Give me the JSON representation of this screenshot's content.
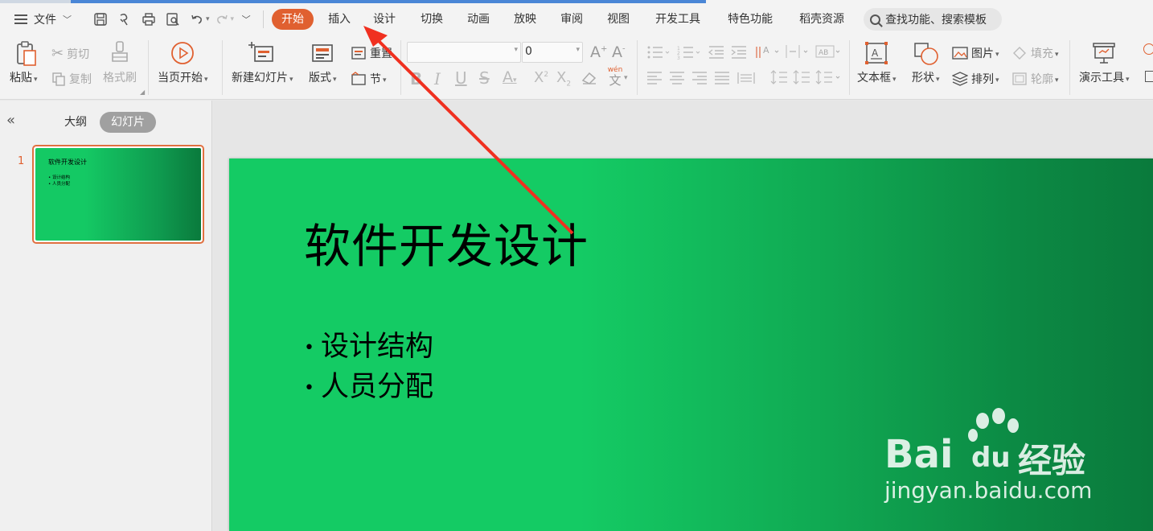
{
  "menubar": {
    "file_label": "文件",
    "tabs": [
      {
        "label": "开始",
        "active": true
      },
      {
        "label": "插入"
      },
      {
        "label": "设计"
      },
      {
        "label": "切换"
      },
      {
        "label": "动画"
      },
      {
        "label": "放映"
      },
      {
        "label": "审阅"
      },
      {
        "label": "视图"
      },
      {
        "label": "开发工具"
      },
      {
        "label": "特色功能"
      },
      {
        "label": "稻壳资源"
      }
    ],
    "search_label": "查找功能、搜索模板"
  },
  "ribbon": {
    "paste": "粘贴",
    "cut": "剪切",
    "copy": "复制",
    "format_painter": "格式刷",
    "play_current": "当页开始",
    "new_slide": "新建幻灯片",
    "layout": "版式",
    "reset": "重置",
    "section": "节",
    "font_size": "0",
    "textbox": "文本框",
    "shape": "形状",
    "picture": "图片",
    "arrange": "排列",
    "fill": "填充",
    "outline": "轮廓",
    "presenter_tools": "演示工具",
    "phonetic": "wén",
    "phonetic_char": "文"
  },
  "left_panel": {
    "tab_outline": "大纲",
    "tab_slides": "幻灯片",
    "slide_number": "1"
  },
  "slide": {
    "title": "软件开发设计",
    "bullets": [
      "设计结构",
      "人员分配"
    ]
  },
  "watermark": {
    "brand": "Bai",
    "brand2": "du",
    "cn": "经验",
    "url": "jingyan.baidu.com"
  },
  "colors": {
    "accent": "#e06030",
    "slide_green": "#14cb64",
    "slide_green_dark": "#0a7a3c",
    "annotation_arrow": "#f03020"
  }
}
